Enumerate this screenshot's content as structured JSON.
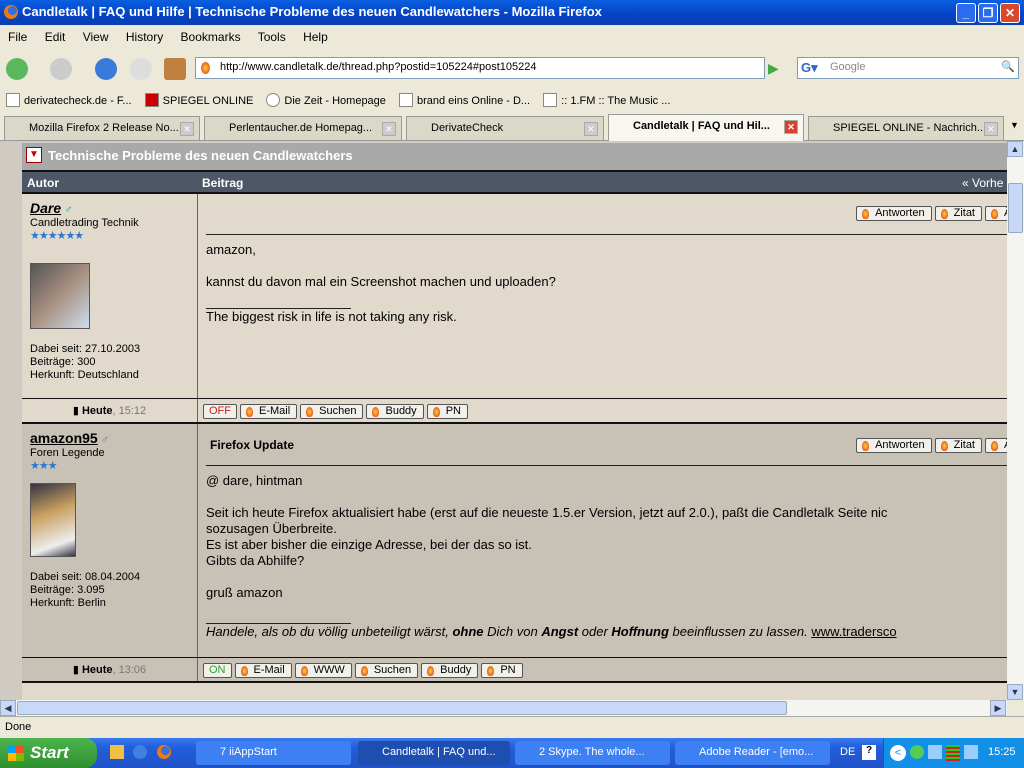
{
  "window": {
    "title": "Candletalk | FAQ und Hilfe | Technische Probleme des neuen Candlewatchers - Mozilla Firefox"
  },
  "menu": [
    "File",
    "Edit",
    "View",
    "History",
    "Bookmarks",
    "Tools",
    "Help"
  ],
  "toolbar": {
    "url": "http://www.candletalk.de/thread.php?postid=105224#post105224",
    "search_placeholder": "Google"
  },
  "bookmarks": [
    "derivatecheck.de - F...",
    "SPIEGEL ONLINE",
    "Die Zeit - Homepage",
    "brand eins Online - D...",
    ":: 1.FM :: The Music ..."
  ],
  "tabs": [
    {
      "label": "Mozilla Firefox 2 Release No..."
    },
    {
      "label": "Perlentaucher.de Homepag..."
    },
    {
      "label": "DerivateCheck"
    },
    {
      "label": "Candletalk | FAQ und Hil..."
    },
    {
      "label": "SPIEGEL ONLINE - Nachrich..."
    }
  ],
  "thread": {
    "title": "Technische Probleme des neuen Candlewatchers",
    "col_author": "Autor",
    "col_post": "Beitrag",
    "nav_prev": "« Vorhe"
  },
  "buttons": {
    "reply": "Antworten",
    "quote": "Zitat",
    "edit": "Ä",
    "email": "E-Mail",
    "www": "WWW",
    "search": "Suchen",
    "buddy": "Buddy",
    "pm": "PN"
  },
  "posts": [
    {
      "user": "Dare",
      "rank": "Candletrading Technik",
      "stars": "★★★★★★",
      "joined": "Dabei seit: 27.10.2003",
      "count": "Beiträge: 300",
      "origin": "Herkunft: Deutschland",
      "subject": "",
      "lines": [
        "amazon,",
        "",
        "kannst du davon mal ein Screenshot machen und uploaden?"
      ],
      "signature": "The biggest risk in life is not taking any risk.",
      "day": "Heute",
      "time": ", 15:12",
      "online": "OFF"
    },
    {
      "user": "amazon95",
      "rank": "Foren Legende",
      "stars": "★★★",
      "joined": "Dabei seit: 08.04.2004",
      "count": "Beiträge: 3.095",
      "origin": "Herkunft: Berlin",
      "subject": "Firefox Update",
      "lines": [
        "@ dare, hintman",
        "",
        "Seit ich heute Firefox aktualisiert habe (erst auf die neueste 1.5.er Version, jetzt auf 2.0.), paßt die Candletalk Seite nic",
        "sozusagen Überbreite.",
        "Es ist aber bisher die einzige Adresse, bei der das so ist.",
        "Gibts da Abhilfe?",
        "",
        "gruß amazon"
      ],
      "sig_parts": [
        "Handele, als ob du völlig unbeteiligt wärst, ",
        "ohne",
        " Dich von ",
        "Angst",
        " oder ",
        "Hoffnung",
        " beeinflussen zu lassen. "
      ],
      "sig_link": "www.tradersco",
      "day": "Heute",
      "time": ", 13:06",
      "online": "ON"
    }
  ],
  "status": "Done",
  "taskbar": {
    "start": "Start",
    "tasks": [
      "7 iiAppStart",
      "Candletalk | FAQ und...",
      "2 Skype. The whole...",
      "Adobe Reader - [emo..."
    ],
    "lang": "DE",
    "clock": "15:25"
  }
}
